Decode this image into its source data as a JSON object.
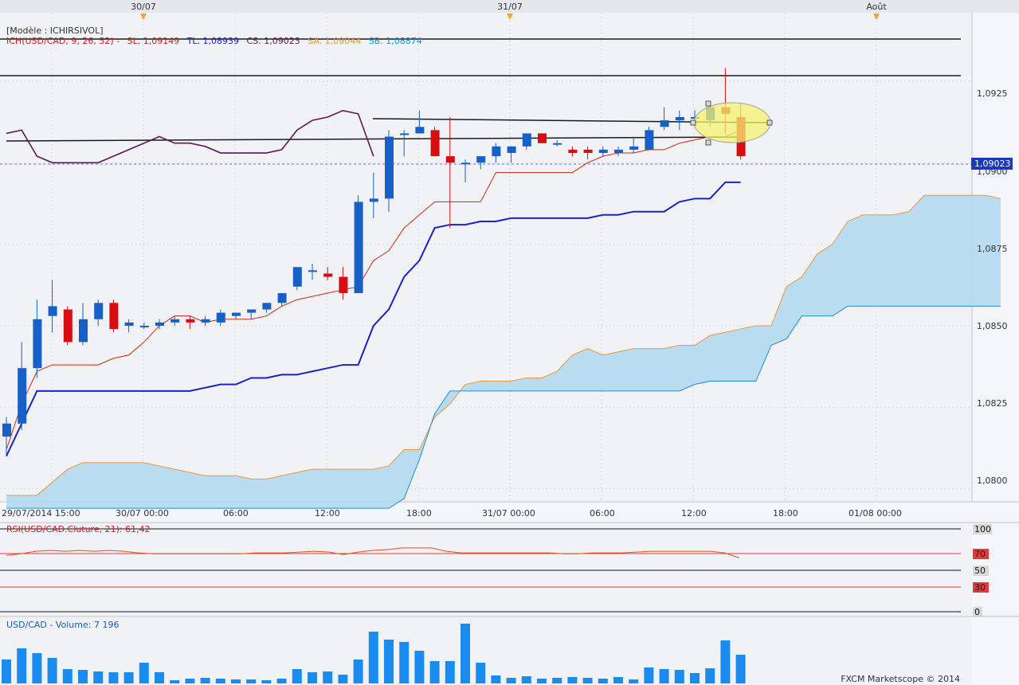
{
  "header": {
    "model_label": "[Modèle : ICHIRSIVOL]",
    "ich_label": "ICH(USD/CAD, 9, 26, 52) -",
    "sl_label": "SL. 1,09149",
    "tl_label": "TL. 1,08939",
    "cs_label": "CS. 1,09023",
    "sa_label": "SA. 1,09044",
    "sb_label": "SB. 1,08874"
  },
  "top_dates": [
    "30/07",
    "31/07",
    "Août"
  ],
  "price_ticks": [
    "1,0925",
    "1,0900",
    "1,0875",
    "1,0850",
    "1,0825",
    "1,0800"
  ],
  "current_price_label": "1,09023",
  "time_ticks": [
    "29/07/2014 15:00",
    "30/07 00:00",
    "06:00",
    "12:00",
    "18:00",
    "31/07 00:00",
    "06:00",
    "12:00",
    "18:00",
    "01/08 00:00"
  ],
  "rsi": {
    "label": "RSI(USD/CAD.Cluture, 21): 61,42",
    "levels": [
      "100",
      "70",
      "50",
      "30",
      "0"
    ],
    "level_colors": {
      "100": "#d9d9d9",
      "70": "#e23a3a",
      "50": "#d9d9d9",
      "30": "#e23a3a",
      "0": "#d9d9d9"
    },
    "values": [
      68,
      70,
      73,
      74,
      73,
      74,
      73,
      74,
      73,
      71,
      70,
      70,
      70,
      70,
      70,
      70,
      70,
      71,
      71,
      71,
      72,
      73,
      72,
      69,
      72,
      74,
      75,
      77,
      77,
      77,
      73,
      71,
      71,
      71,
      71,
      71,
      71,
      71,
      70,
      70,
      71,
      71,
      71,
      72,
      73,
      73,
      73,
      73,
      73,
      71,
      65
    ]
  },
  "volume": {
    "label": "USD/CAD - Volume: 7 196",
    "values": [
      30,
      44,
      38,
      32,
      18,
      17,
      15,
      14,
      14,
      26,
      14,
      4,
      6,
      7,
      6,
      5,
      5,
      4,
      6,
      18,
      14,
      15,
      11,
      30,
      65,
      55,
      52,
      41,
      28,
      28,
      75,
      26,
      10,
      7,
      9,
      6,
      7,
      8,
      7,
      6,
      8,
      5,
      20,
      18,
      17,
      13,
      19,
      54,
      36
    ],
    "max": 80
  },
  "copyright": "FXCM Marketscope © 2014",
  "colors": {
    "bull": "#1660c8",
    "bear": "#d80d12",
    "kijun": "#1b22c8",
    "tenkan": "#d9230e",
    "chikou": "#5c1850",
    "cloud": "#b2d9f0",
    "senkou_a": "#f0963a",
    "senkou_b": "#1f90d8",
    "volume": "#1a8cf0",
    "rsi": "#e05020"
  },
  "chart_data": {
    "type": "candlestick",
    "symbol": "USD/CAD",
    "timeframe_note": "hourly candles, 29/07/2014 15:00 to 31/07/2014 15:00",
    "ylim": [
      1.0796,
      1.0946
    ],
    "candles": [
      {
        "o": 1.0816,
        "h": 1.0822,
        "l": 1.081,
        "c": 1.082
      },
      {
        "o": 1.082,
        "h": 1.0845,
        "l": 1.0818,
        "c": 1.0837
      },
      {
        "o": 1.0837,
        "h": 1.0858,
        "l": 1.0834,
        "c": 1.0852
      },
      {
        "o": 1.0853,
        "h": 1.0864,
        "l": 1.0848,
        "c": 1.0856
      },
      {
        "o": 1.0855,
        "h": 1.0856,
        "l": 1.0844,
        "c": 1.0845
      },
      {
        "o": 1.0845,
        "h": 1.0857,
        "l": 1.0844,
        "c": 1.0852
      },
      {
        "o": 1.0852,
        "h": 1.0858,
        "l": 1.085,
        "c": 1.0857
      },
      {
        "o": 1.0857,
        "h": 1.0858,
        "l": 1.0848,
        "c": 1.0849
      },
      {
        "o": 1.085,
        "h": 1.0852,
        "l": 1.0848,
        "c": 1.0851
      },
      {
        "o": 1.085,
        "h": 1.0851,
        "l": 1.0849,
        "c": 1.085
      },
      {
        "o": 1.085,
        "h": 1.0852,
        "l": 1.0849,
        "c": 1.0851
      },
      {
        "o": 1.0851,
        "h": 1.0853,
        "l": 1.085,
        "c": 1.0852
      },
      {
        "o": 1.0852,
        "h": 1.0853,
        "l": 1.0849,
        "c": 1.0851
      },
      {
        "o": 1.0851,
        "h": 1.0853,
        "l": 1.085,
        "c": 1.0852
      },
      {
        "o": 1.0851,
        "h": 1.0855,
        "l": 1.085,
        "c": 1.0854
      },
      {
        "o": 1.0853,
        "h": 1.0854,
        "l": 1.0852,
        "c": 1.0854
      },
      {
        "o": 1.0854,
        "h": 1.0855,
        "l": 1.0852,
        "c": 1.0855
      },
      {
        "o": 1.0855,
        "h": 1.0857,
        "l": 1.0854,
        "c": 1.0857
      },
      {
        "o": 1.0857,
        "h": 1.086,
        "l": 1.0856,
        "c": 1.086
      },
      {
        "o": 1.0862,
        "h": 1.0868,
        "l": 1.0861,
        "c": 1.0868
      },
      {
        "o": 1.0867,
        "h": 1.0869,
        "l": 1.0864,
        "c": 1.0867
      },
      {
        "o": 1.0866,
        "h": 1.0868,
        "l": 1.0864,
        "c": 1.0865
      },
      {
        "o": 1.0865,
        "h": 1.0868,
        "l": 1.0858,
        "c": 1.086
      },
      {
        "o": 1.086,
        "h": 1.089,
        "l": 1.086,
        "c": 1.0888
      },
      {
        "o": 1.0888,
        "h": 1.0897,
        "l": 1.0883,
        "c": 1.0889
      },
      {
        "o": 1.0889,
        "h": 1.091,
        "l": 1.0885,
        "c": 1.0908
      },
      {
        "o": 1.0909,
        "h": 1.091,
        "l": 1.0902,
        "c": 1.0909
      },
      {
        "o": 1.0909,
        "h": 1.0916,
        "l": 1.0909,
        "c": 1.0911
      },
      {
        "o": 1.091,
        "h": 1.0911,
        "l": 1.0902,
        "c": 1.0902
      },
      {
        "o": 1.0902,
        "h": 1.0914,
        "l": 1.088,
        "c": 1.09
      },
      {
        "o": 1.09,
        "h": 1.0901,
        "l": 1.0894,
        "c": 1.09
      },
      {
        "o": 1.09,
        "h": 1.0902,
        "l": 1.0898,
        "c": 1.0902
      },
      {
        "o": 1.0902,
        "h": 1.0906,
        "l": 1.09,
        "c": 1.0905
      },
      {
        "o": 1.0903,
        "h": 1.0905,
        "l": 1.09,
        "c": 1.0905
      },
      {
        "o": 1.0905,
        "h": 1.0909,
        "l": 1.0904,
        "c": 1.0909
      },
      {
        "o": 1.0909,
        "h": 1.0909,
        "l": 1.0906,
        "c": 1.0906
      },
      {
        "o": 1.0906,
        "h": 1.0907,
        "l": 1.0905,
        "c": 1.0906
      },
      {
        "o": 1.0904,
        "h": 1.0905,
        "l": 1.0902,
        "c": 1.0903
      },
      {
        "o": 1.0904,
        "h": 1.0905,
        "l": 1.0901,
        "c": 1.0903
      },
      {
        "o": 1.0903,
        "h": 1.0905,
        "l": 1.0902,
        "c": 1.0904
      },
      {
        "o": 1.0903,
        "h": 1.0905,
        "l": 1.0902,
        "c": 1.0904
      },
      {
        "o": 1.0904,
        "h": 1.0908,
        "l": 1.0903,
        "c": 1.0905
      },
      {
        "o": 1.0904,
        "h": 1.0911,
        "l": 1.0904,
        "c": 1.091
      },
      {
        "o": 1.0911,
        "h": 1.0917,
        "l": 1.091,
        "c": 1.0913
      },
      {
        "o": 1.0913,
        "h": 1.0916,
        "l": 1.091,
        "c": 1.0914
      },
      {
        "o": 1.0914,
        "h": 1.0916,
        "l": 1.0911,
        "c": 1.0914
      },
      {
        "o": 1.0913,
        "h": 1.0918,
        "l": 1.0911,
        "c": 1.0917
      },
      {
        "o": 1.0917,
        "h": 1.0929,
        "l": 1.0909,
        "c": 1.0915
      },
      {
        "o": 1.0914,
        "h": 1.0918,
        "l": 1.0901,
        "c": 1.0902
      }
    ],
    "kijun": [
      1.081,
      1.082,
      1.083,
      1.083,
      1.083,
      1.083,
      1.083,
      1.083,
      1.083,
      1.083,
      1.083,
      1.083,
      1.083,
      1.0831,
      1.0832,
      1.0832,
      1.0834,
      1.0834,
      1.0835,
      1.0835,
      1.0836,
      1.0837,
      1.0838,
      1.0838,
      1.085,
      1.0855,
      1.0865,
      1.087,
      1.088,
      1.0881,
      1.0881,
      1.0882,
      1.0882,
      1.0883,
      1.0883,
      1.0883,
      1.0883,
      1.0883,
      1.0883,
      1.0884,
      1.0884,
      1.0885,
      1.0885,
      1.0885,
      1.0888,
      1.0889,
      1.0889,
      1.0894,
      1.0894
    ],
    "tenkan": [
      1.0812,
      1.0826,
      1.0836,
      1.0838,
      1.0838,
      1.0838,
      1.0838,
      1.084,
      1.0841,
      1.0845,
      1.085,
      1.0853,
      1.0853,
      1.0851,
      1.0852,
      1.0852,
      1.0852,
      1.0853,
      1.0856,
      1.0858,
      1.0859,
      1.086,
      1.0861,
      1.0862,
      1.087,
      1.0873,
      1.088,
      1.0884,
      1.0888,
      1.0888,
      1.0888,
      1.0888,
      1.0897,
      1.0897,
      1.0897,
      1.0897,
      1.0897,
      1.0897,
      1.09,
      1.0902,
      1.0903,
      1.0903,
      1.0904,
      1.0904,
      1.0906,
      1.0907,
      1.0908,
      1.0908,
      1.091
    ],
    "chikou": [
      1.0909,
      1.091,
      1.0902,
      1.09,
      1.09,
      1.09,
      1.09,
      1.0902,
      1.0904,
      1.0906,
      1.0908,
      1.0906,
      1.0906,
      1.0905,
      1.0903,
      1.0903,
      1.0903,
      1.0903,
      1.0904,
      1.091,
      1.0913,
      1.0914,
      1.0916,
      1.0915,
      1.0902
    ],
    "senkou_a": [
      1.0798,
      1.0798,
      1.0798,
      1.0802,
      1.0806,
      1.0808,
      1.0808,
      1.0808,
      1.0808,
      1.0808,
      1.0807,
      1.0806,
      1.0805,
      1.0804,
      1.0804,
      1.0804,
      1.0803,
      1.0803,
      1.0804,
      1.0805,
      1.0806,
      1.0806,
      1.0806,
      1.0806,
      1.0806,
      1.0807,
      1.0812,
      1.0812,
      1.0822,
      1.0826,
      1.0832,
      1.0833,
      1.0833,
      1.0833,
      1.0834,
      1.0834,
      1.0836,
      1.0841,
      1.0843,
      1.0841,
      1.0842,
      1.0843,
      1.0843,
      1.0843,
      1.0844,
      1.0844,
      1.0847,
      1.0848,
      1.0849,
      1.085,
      1.085,
      1.0862,
      1.0865,
      1.0872,
      1.0875,
      1.0882,
      1.0884,
      1.0884,
      1.0884,
      1.0885,
      1.089,
      1.089,
      1.089,
      1.089,
      1.089,
      1.0889
    ],
    "senkou_b": [
      1.0794,
      1.0794,
      1.0794,
      1.0794,
      1.0794,
      1.0794,
      1.0794,
      1.0794,
      1.0794,
      1.0794,
      1.0794,
      1.0794,
      1.0794,
      1.0794,
      1.0794,
      1.0794,
      1.0794,
      1.0794,
      1.0794,
      1.0794,
      1.0794,
      1.0794,
      1.0794,
      1.0794,
      1.0794,
      1.0794,
      1.0797,
      1.0809,
      1.0823,
      1.083,
      1.083,
      1.083,
      1.083,
      1.083,
      1.083,
      1.083,
      1.083,
      1.083,
      1.083,
      1.083,
      1.083,
      1.083,
      1.083,
      1.083,
      1.083,
      1.0832,
      1.0833,
      1.0833,
      1.0833,
      1.0833,
      1.0844,
      1.0846,
      1.0853,
      1.0853,
      1.0853,
      1.0856,
      1.0856,
      1.0856,
      1.0856,
      1.0856,
      1.0856,
      1.0856,
      1.0856,
      1.0856,
      1.0856,
      1.0856
    ]
  }
}
